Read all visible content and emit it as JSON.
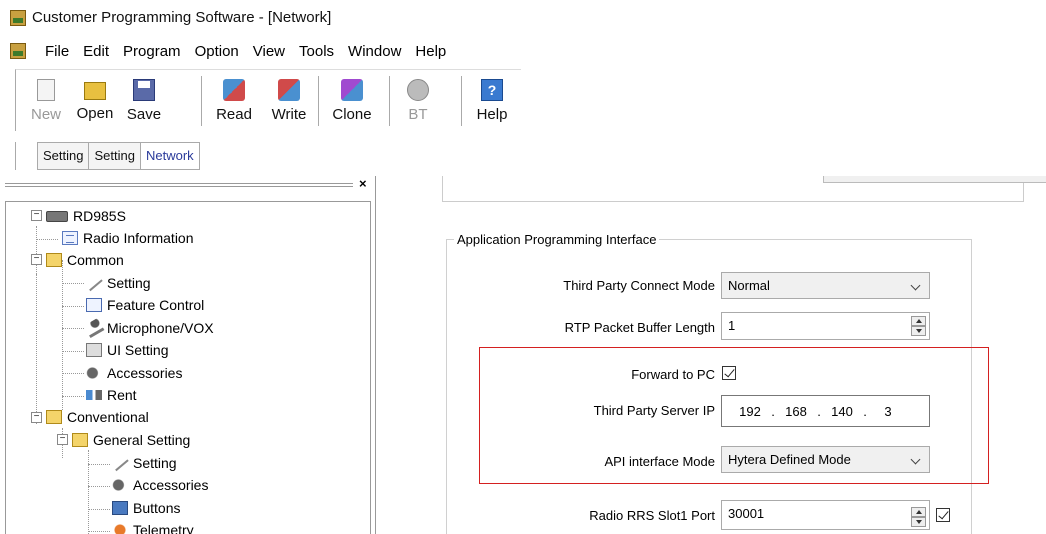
{
  "window": {
    "title": "Customer Programming Software - [Network]"
  },
  "menu": {
    "items": [
      "File",
      "Edit",
      "Program",
      "Option",
      "View",
      "Tools",
      "Window",
      "Help"
    ]
  },
  "toolbar": {
    "buttons": [
      {
        "label": "New",
        "icon": "new-file-icon",
        "enabled": false
      },
      {
        "label": "Open",
        "icon": "open-folder-icon",
        "enabled": true
      },
      {
        "label": "Save",
        "icon": "floppy-disk-icon",
        "enabled": true
      },
      {
        "label": "Read",
        "icon": "read-radio-icon",
        "enabled": true
      },
      {
        "label": "Write",
        "icon": "write-radio-icon",
        "enabled": true
      },
      {
        "label": "Clone",
        "icon": "clone-radio-icon",
        "enabled": true
      },
      {
        "label": "BT",
        "icon": "bluetooth-icon",
        "enabled": false
      },
      {
        "label": "Help",
        "icon": "help-icon",
        "enabled": true
      }
    ]
  },
  "tabs": [
    {
      "label": "Setting",
      "active": false
    },
    {
      "label": "Setting",
      "active": false
    },
    {
      "label": "Network",
      "active": true
    }
  ],
  "tree": {
    "close_glyph": "×",
    "nodes": [
      {
        "label": "RD985S",
        "icon": "radio-device-icon",
        "expander": "−"
      },
      {
        "label": "Radio Information",
        "icon": "document-icon"
      },
      {
        "label": "Common",
        "icon": "folder-open-icon",
        "expander": "−"
      },
      {
        "label": "Setting",
        "icon": "wrench-icon"
      },
      {
        "label": "Feature Control",
        "icon": "list-icon"
      },
      {
        "label": "Microphone/VOX",
        "icon": "microphone-icon"
      },
      {
        "label": "UI Setting",
        "icon": "ui-setting-icon"
      },
      {
        "label": "Accessories",
        "icon": "accessories-icon"
      },
      {
        "label": "Rent",
        "icon": "rent-icon"
      },
      {
        "label": "Conventional",
        "icon": "folder-open-icon",
        "expander": "−"
      },
      {
        "label": "General Setting",
        "icon": "folder-open-icon",
        "expander": "−"
      },
      {
        "label": "Setting",
        "icon": "wrench-icon"
      },
      {
        "label": "Accessories",
        "icon": "accessories-icon"
      },
      {
        "label": "Buttons",
        "icon": "buttons-icon"
      },
      {
        "label": "Telemetry",
        "icon": "telemetry-icon"
      }
    ]
  },
  "api_group": {
    "title": "Application Programming Interface",
    "third_party_connect_mode": {
      "label": "Third Party Connect Mode",
      "value": "Normal"
    },
    "rtp_buffer": {
      "label": "RTP Packet Buffer Length",
      "value": "1"
    },
    "forward_to_pc": {
      "label": "Forward to PC",
      "checked": true
    },
    "server_ip": {
      "label": "Third Party Server IP",
      "octets": [
        "192",
        "168",
        "140",
        "3"
      ],
      "dot": "."
    },
    "api_mode": {
      "label": "API interface Mode",
      "value": "Hytera Defined Mode"
    },
    "rrs_slot1_port": {
      "label": "Radio RRS Slot1 Port",
      "value": "30001",
      "checked": true
    }
  },
  "colors": {
    "highlight_border": "#d42020",
    "active_tab_text": "#2a3a9a"
  }
}
